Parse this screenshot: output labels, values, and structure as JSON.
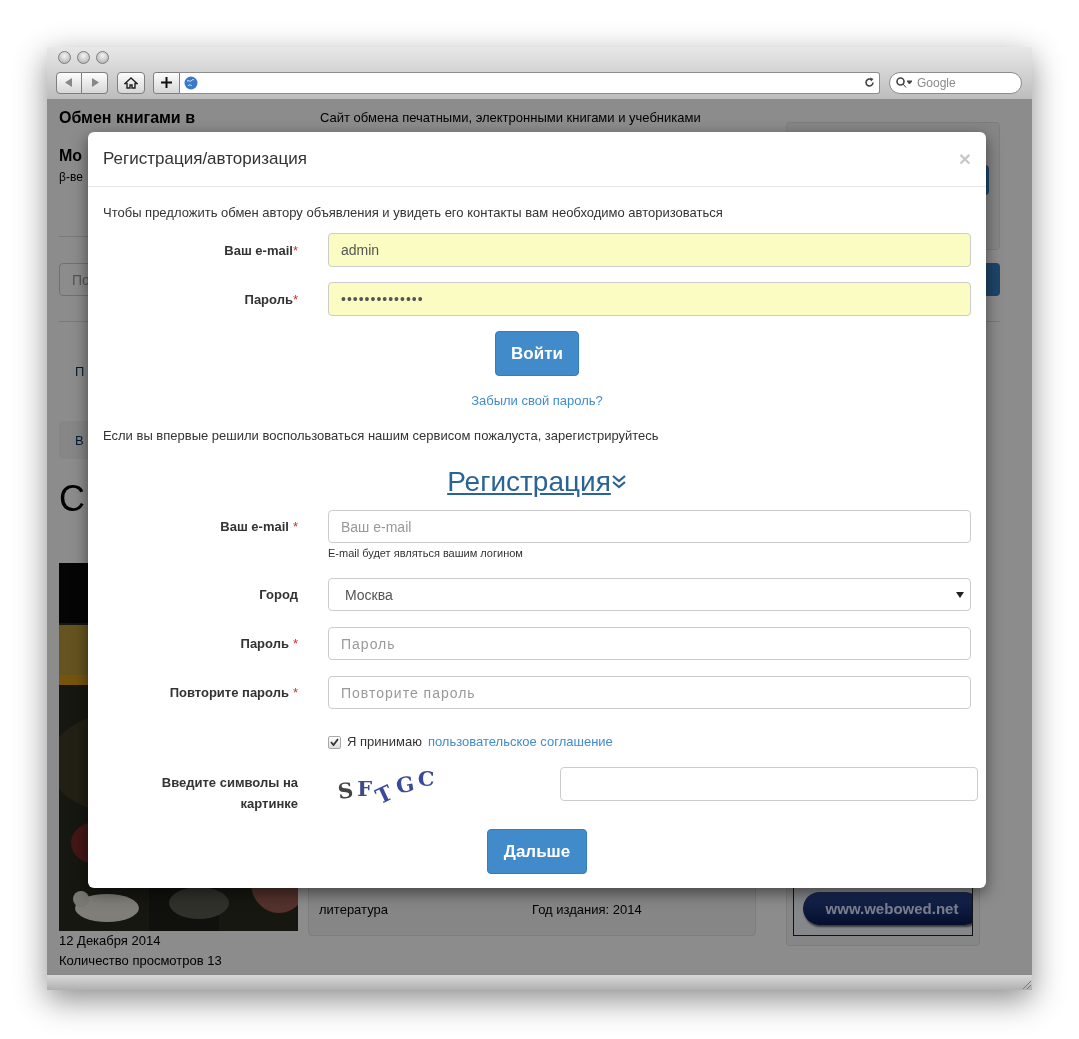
{
  "browser": {
    "search_placeholder": "Google"
  },
  "page": {
    "title_lines": [
      "Обмен книгами в",
      "Мо"
    ],
    "beta": "β-ве",
    "tagline": "Сайт обмена печатными, электронными книгами и учебниками",
    "search_placeholder": "По",
    "nav_item": "П",
    "breadcrumb": "В",
    "heading": "С",
    "listing": {
      "date": "12 Декабря 2014",
      "views": "Количество просмотров 13",
      "genre": "литература",
      "year": "Год издания: 2014"
    },
    "ad": {
      "link": "www.webowed.net"
    }
  },
  "modal": {
    "title": "Регистрация/авторизация",
    "close": "×",
    "login_intro": "Чтобы предложить обмен автору объявления и увидеть его контакты вам необходимо авторизоваться",
    "login_fields": [
      {
        "kind": "text",
        "label": "Ваш e-mail",
        "asterisk": "*",
        "value": "admin",
        "autofilled": true
      },
      {
        "kind": "password",
        "label": "Пароль",
        "asterisk": "*",
        "value": "••••••••••••••",
        "autofilled": true
      }
    ],
    "login_button": "Войти",
    "forgot_link": "Забыли свой пароль?",
    "register_intro": "Если вы впервые решили воспользоваться нашим сервисом пожалуста, зарегистрируйтесь",
    "register_heading": "Регистрация",
    "register_fields": [
      {
        "kind": "text",
        "label": "Ваш e-mail",
        "asterisk": "*",
        "placeholder": "Ваш e-mail",
        "help": "E-mail будет являться вашим логином"
      },
      {
        "kind": "select",
        "label": "Город",
        "value": "Москва"
      },
      {
        "kind": "password",
        "label": "Пароль",
        "asterisk": "*",
        "placeholder": "Пароль"
      },
      {
        "kind": "password",
        "label": "Повторите пароль",
        "asterisk": "*",
        "placeholder": "Повторите пароль"
      }
    ],
    "agreement": {
      "checked": true,
      "text": "Я принимаю",
      "link": "пользовательское соглашение"
    },
    "captcha": {
      "label": "Введите символы на картинке",
      "letters": [
        "S",
        "F",
        "T",
        "G",
        "C"
      ]
    },
    "next_button": "Дальше"
  }
}
